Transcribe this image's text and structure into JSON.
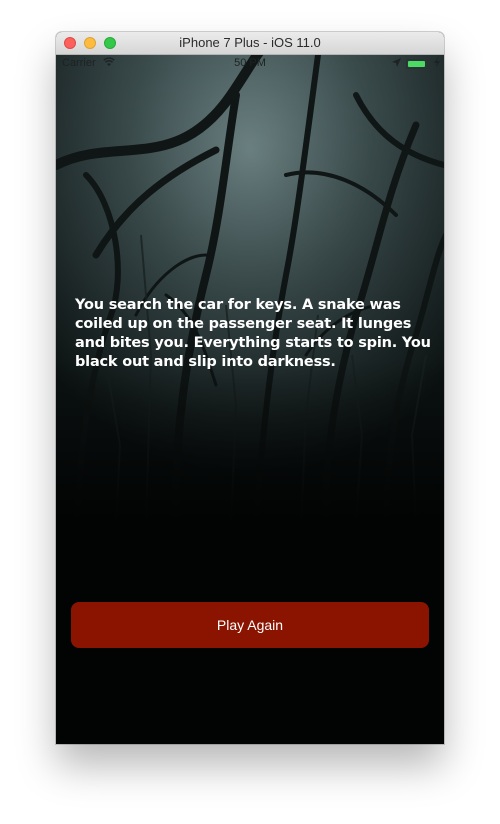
{
  "window": {
    "title": "iPhone 7 Plus - iOS 11.0"
  },
  "status_bar": {
    "carrier": "Carrier",
    "time": "50 PM",
    "battery_color": "#4cd964",
    "battery_level": 0.85,
    "icons": [
      "wifi-icon",
      "location-arrow-icon",
      "battery-icon",
      "charging-bolt-icon"
    ]
  },
  "story": {
    "text": "You search the car for keys. A snake was coiled up on the passenger seat. It lunges and bites you. Everything starts to spin. You black out and slip into darkness."
  },
  "actions": {
    "play_again_label": "Play Again",
    "button_color": "#8b1400"
  }
}
